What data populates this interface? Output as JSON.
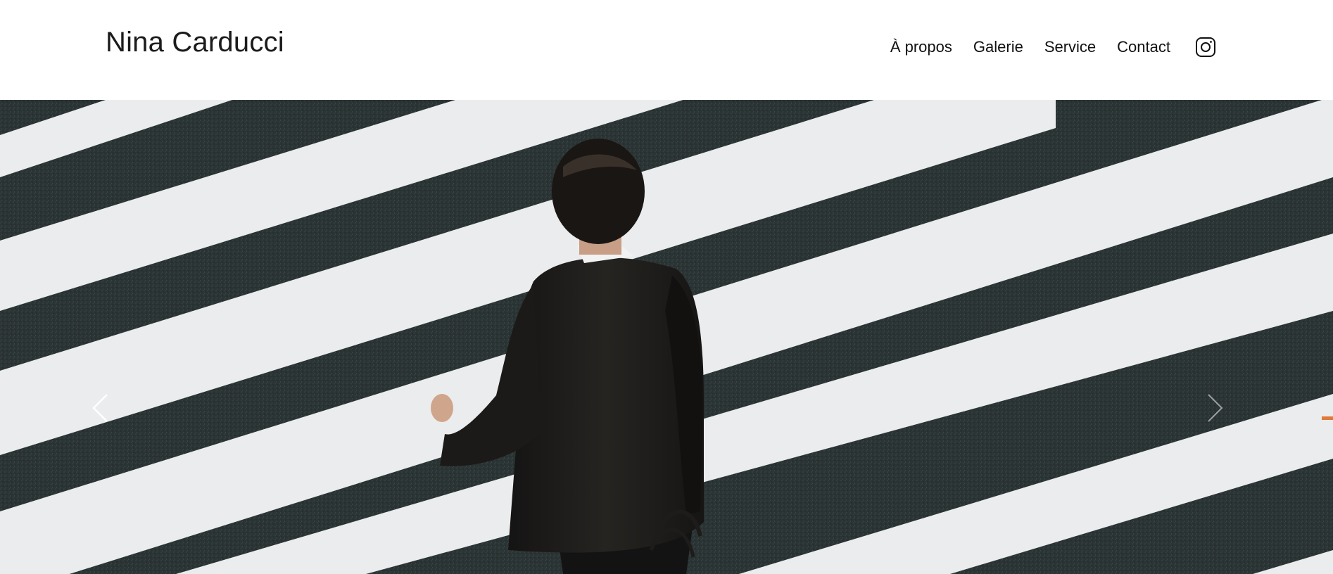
{
  "header": {
    "brand": "Nina Carducci",
    "nav": [
      {
        "label": "À propos"
      },
      {
        "label": "Galerie"
      },
      {
        "label": "Service"
      },
      {
        "label": "Contact"
      }
    ],
    "social_icon": "instagram-icon"
  },
  "carousel": {
    "prev_icon": "chevron-left-icon",
    "next_icon": "chevron-right-icon",
    "image": "man-in-suit-crossing-crosswalk"
  },
  "colors": {
    "background": "#ffffff",
    "text": "#111111",
    "asphalt": "#2a3232",
    "stripe": "#ecedee",
    "suit": "#1e1c1a"
  }
}
